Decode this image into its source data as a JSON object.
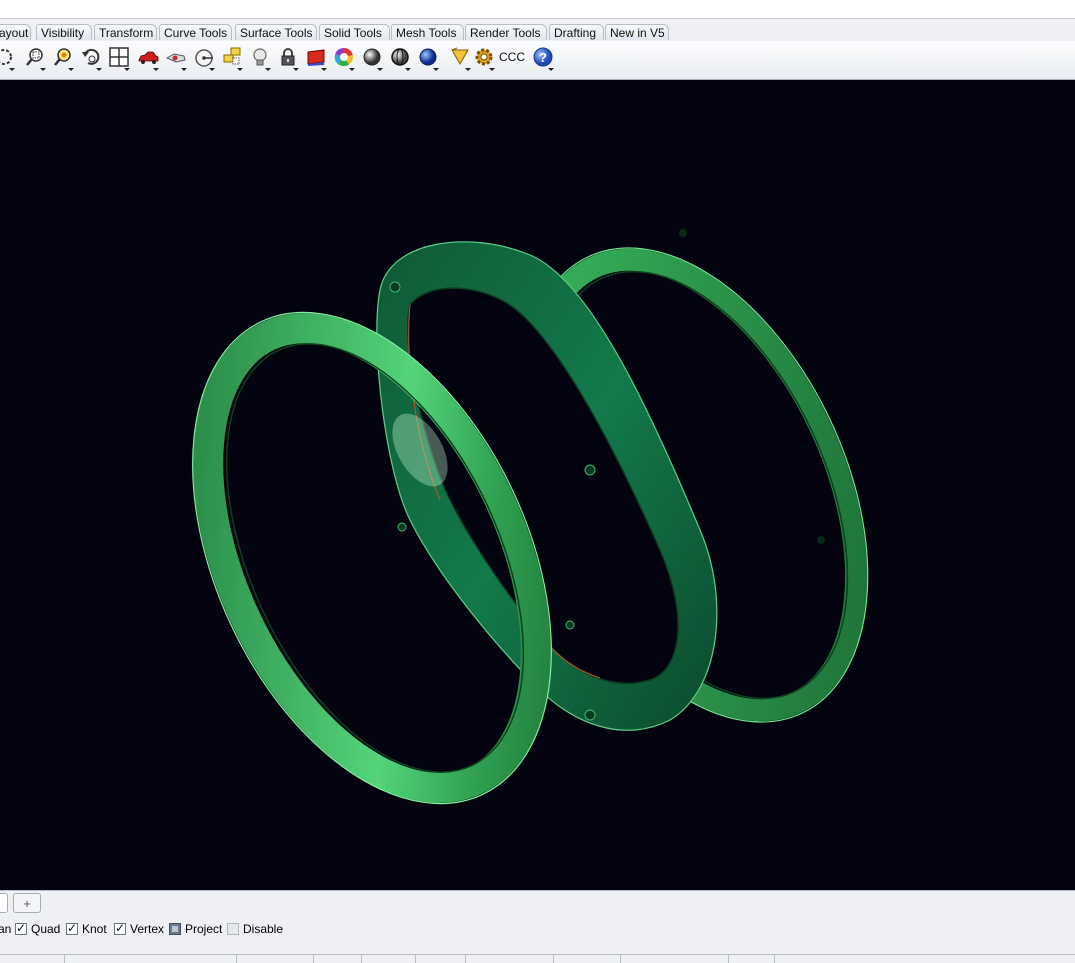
{
  "ribbon_tabs": [
    {
      "label": "ayout"
    },
    {
      "label": "Visibility"
    },
    {
      "label": "Transform"
    },
    {
      "label": "Curve Tools"
    },
    {
      "label": "Surface Tools"
    },
    {
      "label": "Solid Tools"
    },
    {
      "label": "Mesh Tools"
    },
    {
      "label": "Render Tools"
    },
    {
      "label": "Drafting"
    },
    {
      "label": "New in V5"
    }
  ],
  "toolbar": {
    "icons": [
      "zoom-extents-icon",
      "zoom-window-icon",
      "zoom-selected-icon",
      "undo-view-icon",
      "four-viewports-icon",
      "car-icon",
      "named-view-icon",
      "plane-icon",
      "camera-icon",
      "light-bulb-icon",
      "lock-icon",
      "material-icon",
      "color-wheel-icon",
      "shaded-sphere-icon",
      "rendered-sphere-icon",
      "blue-sphere-icon",
      "cone-icon",
      "gear-icon"
    ],
    "ccc_label": "CCC",
    "help_icon": "help-icon"
  },
  "viewport": {
    "background": "#03040f",
    "object_color": "#2f9b53"
  },
  "viewport_tabs": {
    "add_label": "+"
  },
  "osnap": [
    {
      "label": "an",
      "state": "none"
    },
    {
      "label": "Quad",
      "state": "checked"
    },
    {
      "label": "Knot",
      "state": "checked"
    },
    {
      "label": "Vertex",
      "state": "checked"
    },
    {
      "label": "Project",
      "state": "filled"
    },
    {
      "label": "Disable",
      "state": "disabled"
    }
  ]
}
